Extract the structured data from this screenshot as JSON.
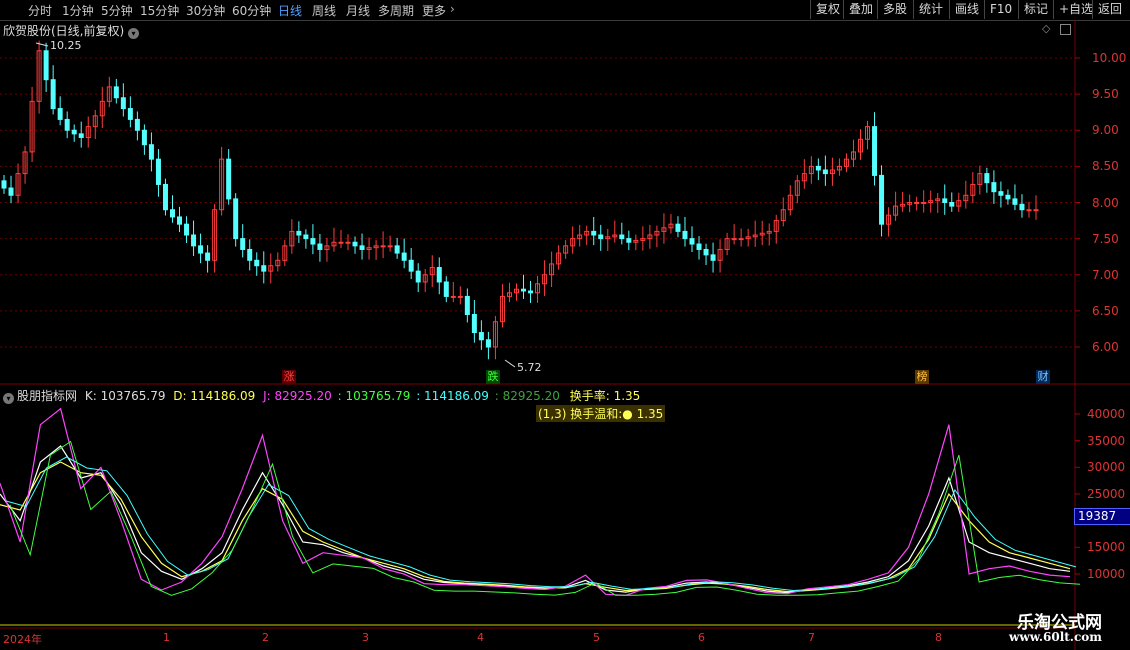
{
  "toolbar": {
    "periods": [
      "分时",
      "1分钟",
      "5分钟",
      "15分钟",
      "30分钟",
      "60分钟",
      "日线",
      "周线",
      "月线",
      "多周期",
      "更多"
    ],
    "active_period": "日线",
    "right_buttons": [
      "复权",
      "叠加",
      "多股",
      "统计",
      "画线",
      "F10",
      "标记",
      "+自选",
      "返回"
    ]
  },
  "main_chart": {
    "title": "欣贺股份(日线,前复权)",
    "high_label": "10.25",
    "low_label": "5.72",
    "y_ticks": [
      "10.00",
      "9.50",
      "9.00",
      "8.50",
      "8.00",
      "7.50",
      "7.00",
      "6.50",
      "6.00"
    ],
    "markers": [
      {
        "text": "涨",
        "color": "#ff4040",
        "bg": "#5a0000"
      },
      {
        "text": "跌",
        "color": "#40ff40",
        "bg": "#004a00"
      },
      {
        "text": "榜",
        "color": "#ffc040",
        "bg": "#5a3a00"
      },
      {
        "text": "财",
        "color": "#80c0ff",
        "bg": "#002a5a"
      }
    ]
  },
  "indicator": {
    "name": "股朋指标网",
    "k_label": "K: 103765.79",
    "d_label": "D: 114186.09",
    "j_label": "J: 82925.20",
    "v1": ": 103765.79",
    "v2": ": 114186.09",
    "v3": ": 82925.20",
    "turnover": "换手率: 1.35",
    "tooltip": "(1,3) 换手温和:● 1.35",
    "y_ticks": [
      "40000",
      "35000",
      "30000",
      "25000",
      "20000",
      "15000",
      "10000"
    ],
    "current_value": "19387"
  },
  "x_axis": {
    "labels": [
      "2024年",
      "1",
      "2",
      "3",
      "4",
      "5",
      "6",
      "7",
      "8"
    ]
  },
  "watermark": {
    "line1": "乐淘公式网",
    "line2": "www.60lt.com"
  },
  "colors": {
    "up": "#ff3d3d",
    "down": "#54ffff",
    "k": "#ffffff",
    "d": "#ffff55",
    "j": "#ff44ff",
    "line_cyan": "#40ffff",
    "line_green": "#40ff40"
  },
  "chart_data": {
    "type": "line",
    "price_series": [
      8.3,
      8.1,
      8.7,
      10.1,
      9.3,
      9.0,
      8.9,
      9.2,
      9.6,
      9.3,
      9.0,
      8.6,
      7.9,
      7.7,
      7.4,
      7.2,
      8.6,
      7.5,
      7.2,
      7.05,
      7.2,
      7.6,
      7.5,
      7.35,
      7.45,
      7.45,
      7.35,
      7.4,
      7.4,
      7.2,
      6.9,
      7.1,
      6.7,
      6.7,
      6.2,
      6.0,
      6.7,
      6.8,
      6.75,
      7.0,
      7.3,
      7.5,
      7.6,
      7.5,
      7.55,
      7.45,
      7.5,
      7.6,
      7.7,
      7.5,
      7.35,
      7.2,
      7.5,
      7.5,
      7.55,
      7.6,
      7.9,
      8.3,
      8.5,
      8.4,
      8.5,
      8.7,
      9.05,
      7.7,
      7.95,
      8.0,
      8.0,
      8.05,
      7.95,
      8.1,
      8.4,
      8.15,
      8.05,
      7.9
    ],
    "kdj_series": [
      {
        "name": "K",
        "values": [
          25000,
          20000,
          31000,
          34000,
          28000,
          29000,
          23000,
          14000,
          10500,
          9000,
          11000,
          14000,
          22000,
          29000,
          23000,
          16000,
          15500,
          14000,
          13000,
          11500,
          10500,
          9000,
          8400,
          8200,
          8000,
          7800,
          7500,
          7300,
          7500,
          8800,
          7000,
          6600,
          7200,
          7500,
          8300,
          8500,
          8100,
          7500,
          6800,
          6500,
          7000,
          7400,
          7800,
          8500,
          9500,
          12500,
          19000,
          28000,
          16000,
          14000,
          13000,
          12000,
          11000,
          10500
        ]
      },
      {
        "name": "D",
        "values": [
          23000,
          22000,
          29000,
          31000,
          29000,
          28500,
          24000,
          17000,
          12000,
          9500,
          10500,
          12500,
          20000,
          26000,
          24000,
          18000,
          16000,
          14500,
          13000,
          12000,
          11000,
          9500,
          8600,
          8300,
          8100,
          7900,
          7600,
          7400,
          7400,
          8200,
          7500,
          6900,
          7100,
          7300,
          7900,
          8300,
          8100,
          7700,
          7100,
          6700,
          6900,
          7200,
          7600,
          8200,
          9100,
          11000,
          16500,
          25000,
          20000,
          16000,
          14000,
          13000,
          12000,
          11000
        ]
      },
      {
        "name": "J",
        "values": [
          27000,
          16000,
          38000,
          41000,
          26000,
          30000,
          20000,
          9000,
          7000,
          8500,
          12000,
          17000,
          26000,
          36000,
          20000,
          12000,
          14000,
          13500,
          13000,
          11000,
          10000,
          8200,
          8000,
          8000,
          7800,
          7600,
          7300,
          7100,
          7700,
          9800,
          6200,
          6000,
          7300,
          7700,
          8800,
          8900,
          8200,
          7300,
          6500,
          6300,
          7200,
          7600,
          8000,
          9000,
          10200,
          15000,
          25000,
          38000,
          10000,
          11000,
          11500,
          10500,
          9800,
          9500
        ]
      }
    ]
  }
}
